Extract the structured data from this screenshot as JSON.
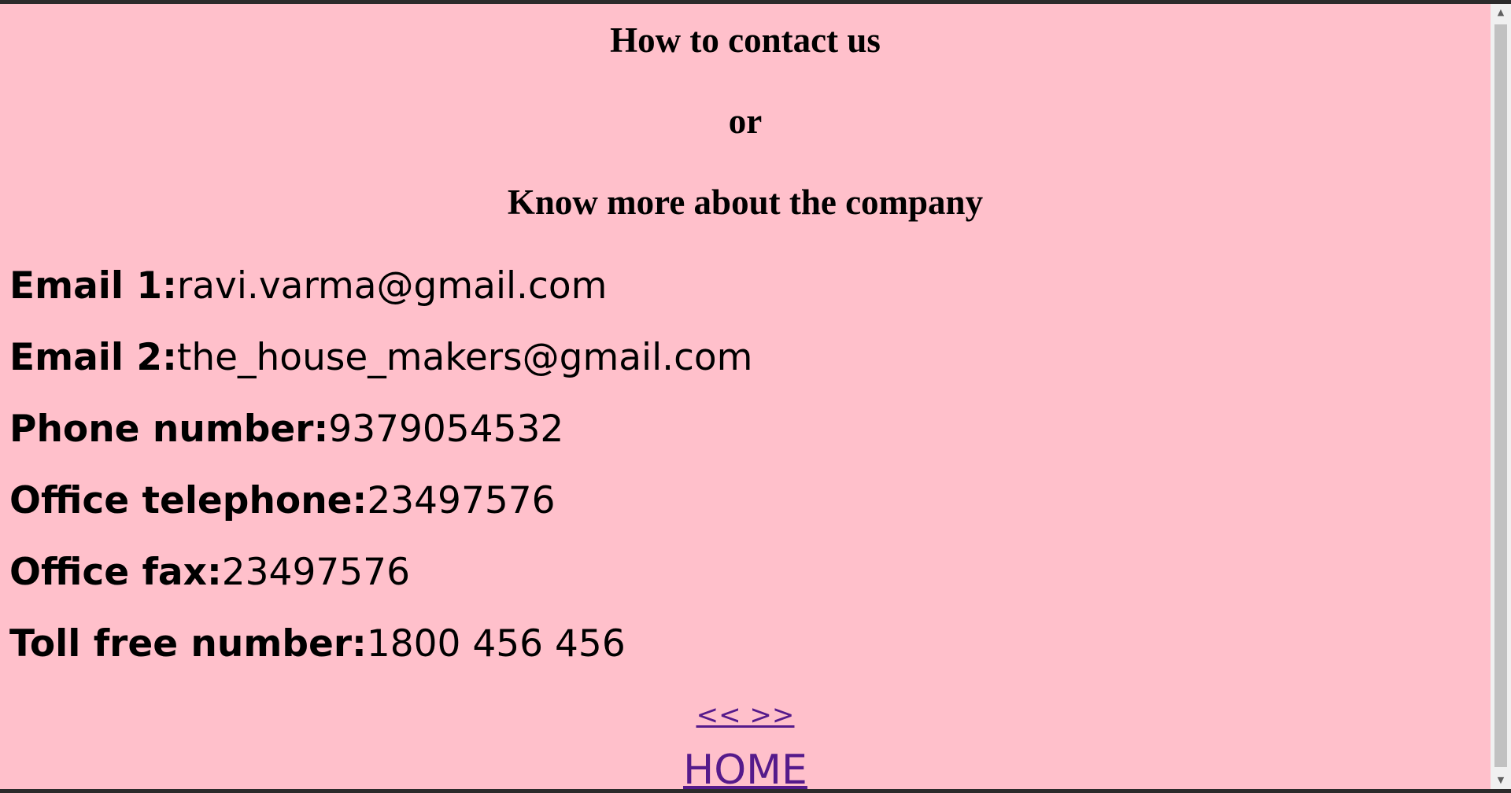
{
  "headings": {
    "line1": "How to contact us",
    "line2": "or",
    "line3": "Know more about the company"
  },
  "contacts": [
    {
      "label": "Email 1:",
      "value": "ravi.varma@gmail.com"
    },
    {
      "label": "Email 2:",
      "value": "the_house_makers@gmail.com"
    },
    {
      "label": "Phone number:",
      "value": "9379054532"
    },
    {
      "label": "Office telephone:",
      "value": "23497576"
    },
    {
      "label": "Office fax:",
      "value": "23497576"
    },
    {
      "label": "Toll free number:",
      "value": "1800 456 456"
    }
  ],
  "nav": {
    "prev": "<<",
    "next": ">>",
    "home": "HOME"
  },
  "colors": {
    "background": "#ffc0cb",
    "link": "#551a8b"
  },
  "icons": {
    "scroll_up": "triangle-up-icon",
    "scroll_down": "triangle-down-icon"
  }
}
